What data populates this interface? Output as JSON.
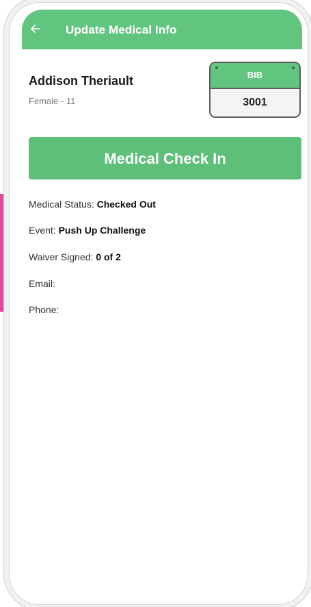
{
  "header": {
    "title": "Update Medical Info",
    "back_icon": "arrow-left-icon"
  },
  "athlete": {
    "name": "Addison Theriault",
    "details": "Female - 11"
  },
  "bib": {
    "label": "BIB",
    "number": "3001"
  },
  "actions": {
    "checkin_label": "Medical Check In"
  },
  "info": {
    "medical_status_label": "Medical Status: ",
    "medical_status_value": "Checked Out",
    "event_label": "Event: ",
    "event_value": "Push Up Challenge",
    "waiver_label": "Waiver Signed: ",
    "waiver_value": "0 of 2",
    "email_label": "Email:",
    "phone_label": "Phone:"
  },
  "colors": {
    "brand_green": "#62c57f",
    "accent_pink": "#e0489a"
  }
}
